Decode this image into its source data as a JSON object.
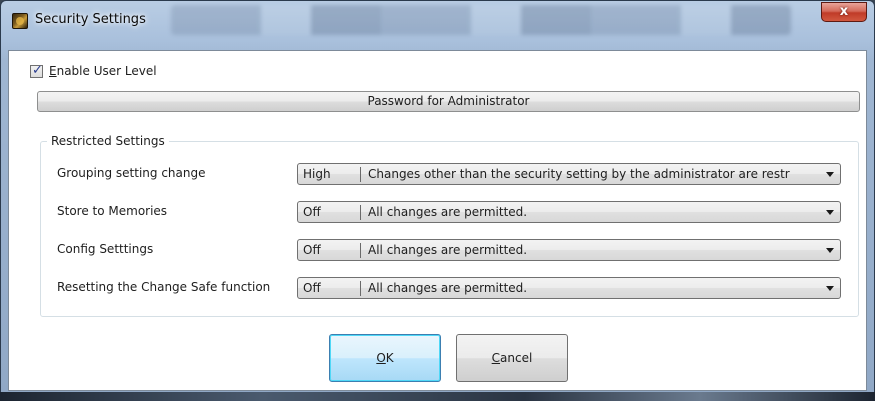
{
  "window": {
    "title": "Security Settings",
    "close_glyph": "x"
  },
  "enable_user_level": {
    "label_access_key": "E",
    "label_rest": "nable User Level",
    "checked": true
  },
  "password_button": {
    "label": "Password for Administrator"
  },
  "restricted": {
    "legend": "Restricted Settings",
    "rows": [
      {
        "label": "Grouping setting change",
        "level": "High",
        "description": "Changes other than the security setting by the administrator are restr"
      },
      {
        "label": "Store to Memories",
        "level": "Off",
        "description": "All changes are permitted."
      },
      {
        "label": "Config Setttings",
        "level": "Off",
        "description": "All changes are permitted."
      },
      {
        "label": "Resetting the Change Safe function",
        "level": "Off",
        "description": "All changes are permitted."
      }
    ]
  },
  "buttons": {
    "ok": {
      "access_key": "O",
      "rest": "K"
    },
    "cancel": {
      "access_key": "C",
      "rest": "ancel"
    }
  },
  "colors": {
    "default_button_border": "#3c7fb1",
    "close_button": "#c03b28",
    "check_mark": "#2b3d8f"
  },
  "icons": {
    "app": "app-logo-icon",
    "close": "close-icon",
    "check": "checkmark-icon",
    "dropdown": "chevron-down-icon"
  }
}
